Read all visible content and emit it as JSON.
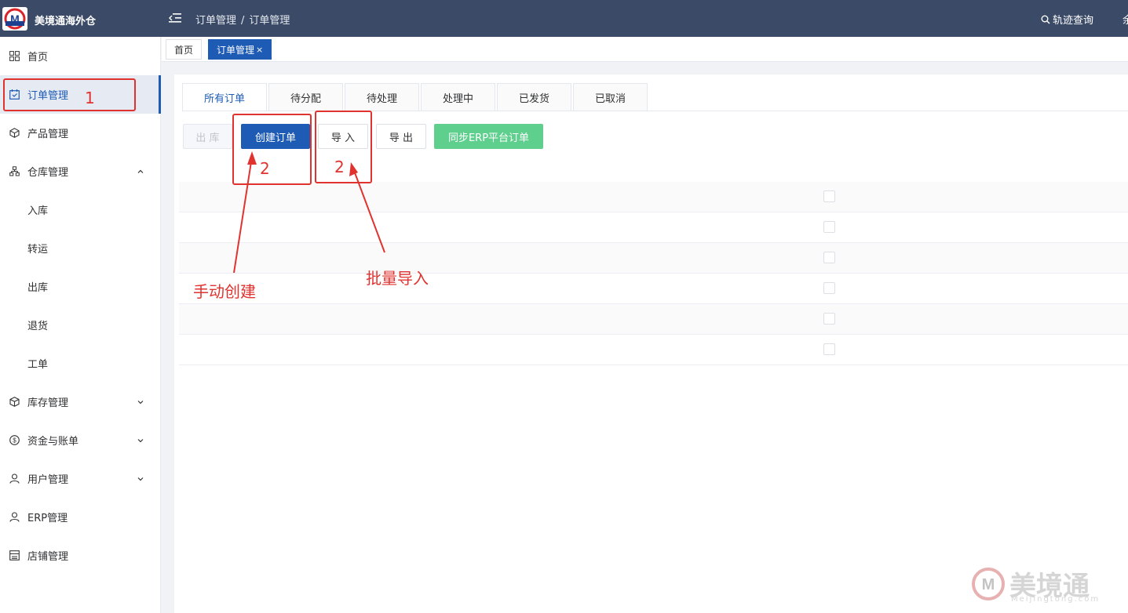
{
  "header": {
    "brand_name": "美境通海外仓",
    "breadcrumb": [
      "订单管理",
      "订单管理"
    ],
    "breadcrumb_sep": "/",
    "track_label": "轨迹查询",
    "cut_text": "余"
  },
  "sidebar": {
    "items": [
      {
        "label": "首页",
        "icon": "grid-icon"
      },
      {
        "label": "订单管理",
        "icon": "calendar-icon"
      },
      {
        "label": "产品管理",
        "icon": "box-icon"
      },
      {
        "label": "仓库管理",
        "icon": "warehouse-icon"
      },
      {
        "label": "入库"
      },
      {
        "label": "转运"
      },
      {
        "label": "出库"
      },
      {
        "label": "退货"
      },
      {
        "label": "工单"
      },
      {
        "label": "库存管理",
        "icon": "cube-icon"
      },
      {
        "label": "资金与账单",
        "icon": "dollar-icon"
      },
      {
        "label": "用户管理",
        "icon": "user-icon"
      },
      {
        "label": "ERP管理",
        "icon": "user-icon"
      },
      {
        "label": "店铺管理",
        "icon": "store-icon"
      }
    ]
  },
  "page_tabs": [
    {
      "label": "首页"
    },
    {
      "label": "订单管理",
      "close": "×"
    }
  ],
  "status_tabs": [
    "所有订单",
    "待分配",
    "待处理",
    "处理中",
    "已发货",
    "已取消"
  ],
  "toolbar": {
    "outbound": "出 库",
    "create": "创建订单",
    "import": "导 入",
    "export": "导 出",
    "sync": "同步ERP平台订单"
  },
  "annotations": {
    "num1": "1",
    "num2a": "2",
    "num2b": "2",
    "manual": "手动创建",
    "batch": "批量导入"
  },
  "watermark": {
    "text": "美境通",
    "sub": "Meijingtong.com"
  },
  "colors": {
    "header_bg": "#3a4a67",
    "primary": "#1d5bb5",
    "success": "#5fcf8d",
    "annotation": "#e0332f"
  }
}
